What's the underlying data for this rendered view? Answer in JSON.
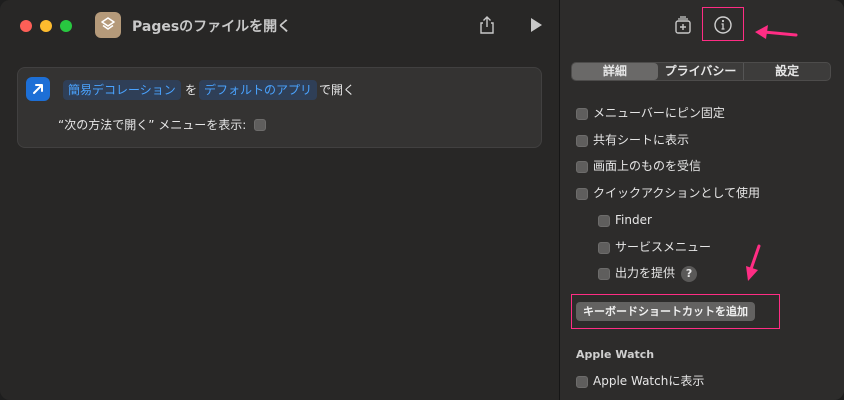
{
  "window": {
    "title": "Pagesのファイルを開く"
  },
  "action": {
    "token_app": "簡易デコレーション",
    "text_wo": "を",
    "token_default": "デフォルトのアプリ",
    "text_open": "で開く",
    "menu_label": "“次の方法で開く” メニューを表示:"
  },
  "inspector": {
    "tabs": [
      {
        "label": "詳細",
        "active": true
      },
      {
        "label": "プライバシー",
        "active": false
      },
      {
        "label": "設定",
        "active": false
      }
    ],
    "options": [
      "メニューバーにピン固定",
      "共有シートに表示",
      "画面上のものを受信",
      "クイックアクションとして使用"
    ],
    "sub_options": [
      "Finder",
      "サービスメニュー",
      "出力を提供"
    ],
    "help_label": "?",
    "keyboard_button": "キーボードショートカットを追加",
    "watch_section": "Apple Watch",
    "watch_option": "Apple Watchに表示"
  },
  "icons": {
    "app": "shortcuts-layers-icon",
    "share": "share-icon",
    "run": "play-icon",
    "library": "add-to-library-icon",
    "info": "info-icon",
    "action": "open-arrow-icon"
  },
  "colors": {
    "accent": "#4aa3ff",
    "highlight": "#ff2d84",
    "action_icon": "#1d6fd6"
  }
}
